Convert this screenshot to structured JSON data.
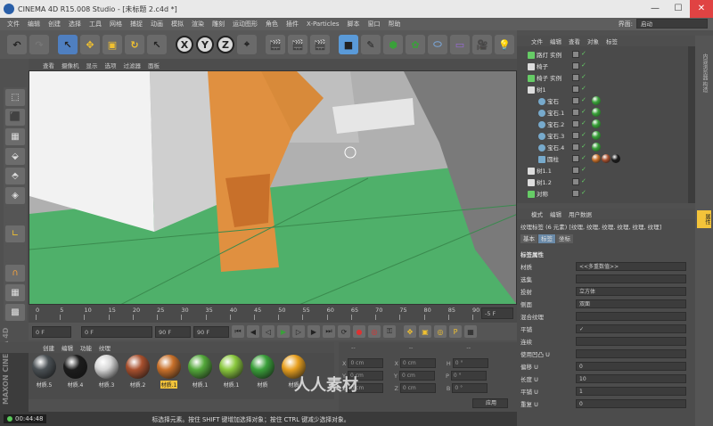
{
  "window": {
    "title": "CINEMA 4D R15.008 Studio - [未标题 2.c4d *]"
  },
  "menu": [
    "文件",
    "编辑",
    "创建",
    "选择",
    "工具",
    "网格",
    "捕捉",
    "动画",
    "模拟",
    "渲染",
    "雕刻",
    "运动图形",
    "角色",
    "插件",
    "X-Particles",
    "脚本",
    "窗口",
    "帮助"
  ],
  "layout": {
    "label": "界面:",
    "value": "启动"
  },
  "viewport": {
    "menu": [
      "查看",
      "摄像机",
      "显示",
      "选项",
      "过滤器",
      "面板"
    ]
  },
  "timeline": {
    "ticks": [
      "0",
      "5",
      "10",
      "15",
      "20",
      "25",
      "30",
      "35",
      "40",
      "45",
      "50",
      "55",
      "60",
      "65",
      "70",
      "75",
      "80",
      "85",
      "90"
    ],
    "end_label": "-5 F"
  },
  "transport": {
    "current": "0 F",
    "start": "0 F",
    "end": "90 F",
    "max": "90 F"
  },
  "materials": {
    "menu": [
      "创建",
      "编辑",
      "功能",
      "纹理"
    ],
    "items": [
      {
        "label": "材质.5",
        "color": "#4a5054"
      },
      {
        "label": "材质.4",
        "color": "#1c1c1c"
      },
      {
        "label": "材质.3",
        "color": "#d6d6d6"
      },
      {
        "label": "材质.2",
        "color": "#a8502e"
      },
      {
        "label": "材质.1",
        "color": "#c8702a",
        "selected": true
      },
      {
        "label": "材质.1",
        "color": "#53a83a"
      },
      {
        "label": "材质.1",
        "color": "#8ac83e"
      },
      {
        "label": "材质",
        "color": "#3aa03a"
      },
      {
        "label": "材质",
        "color": "#e8a020"
      }
    ]
  },
  "coords": {
    "header": [
      "--",
      "--",
      "--"
    ],
    "rows": [
      {
        "a": "X",
        "av": "0 cm",
        "b": "X",
        "bv": "0 cm",
        "c": "H",
        "cv": "0 °"
      },
      {
        "a": "Y",
        "av": "0 cm",
        "b": "Y",
        "bv": "0 cm",
        "c": "P",
        "cv": "0 °"
      },
      {
        "a": "Z",
        "av": "0 cm",
        "b": "Z",
        "bv": "0 cm",
        "c": "B",
        "cv": "0 °"
      }
    ],
    "apply": "应用"
  },
  "status": {
    "time": "00:44:48",
    "message": "标选择元素。按住 SHIFT 键增加选择对象；按住 CTRL 键减少选择对象。"
  },
  "objects": {
    "menu": [
      "文件",
      "编辑",
      "查看",
      "对象",
      "标签"
    ],
    "rows": [
      {
        "name": "路灯 实例",
        "indent": 8,
        "type": "instance"
      },
      {
        "name": "椅子",
        "indent": 8,
        "type": "null"
      },
      {
        "name": "椅子 实例",
        "indent": 8,
        "type": "instance"
      },
      {
        "name": "树1",
        "indent": 8,
        "type": "null"
      },
      {
        "name": "宝石",
        "indent": 20,
        "type": "sphere"
      },
      {
        "name": "宝石.1",
        "indent": 20,
        "type": "sphere"
      },
      {
        "name": "宝石.2",
        "indent": 20,
        "type": "sphere"
      },
      {
        "name": "宝石.3",
        "indent": 20,
        "type": "sphere"
      },
      {
        "name": "宝石.4",
        "indent": 20,
        "type": "sphere"
      },
      {
        "name": "圆柱",
        "indent": 20,
        "type": "cylinder"
      },
      {
        "name": "树1.1",
        "indent": 8,
        "type": "null"
      },
      {
        "name": "树1.2",
        "indent": 8,
        "type": "null"
      },
      {
        "name": "对称",
        "indent": 8,
        "type": "symmetry"
      }
    ]
  },
  "attributes": {
    "menu": [
      "模式",
      "编辑",
      "用户数据"
    ],
    "title": "纹理标签 (6 元素) [纹理, 纹理, 纹理, 纹理, 纹理, 纹理]",
    "tabs": [
      "基本",
      "标签",
      "坐标"
    ],
    "section": "标签属性",
    "fields": [
      {
        "label": "材质",
        "value": "<<多重数值>>"
      },
      {
        "label": "选集",
        "value": ""
      },
      {
        "label": "投射",
        "value": "立方体"
      },
      {
        "label": "侧面",
        "value": "双面"
      },
      {
        "label": "混合纹理",
        "value": ""
      },
      {
        "label": "平铺",
        "value": "✓"
      },
      {
        "label": "连续",
        "value": ""
      },
      {
        "label": "使用凹凸 U",
        "value": ""
      },
      {
        "label": "偏移 U",
        "value": "0"
      },
      {
        "label": "长度 U",
        "value": "10"
      },
      {
        "label": "平铺 U",
        "value": "1"
      },
      {
        "label": "重复 U",
        "value": "0"
      }
    ]
  },
  "rightdock": {
    "tabs": "内容浏览器 构造"
  },
  "watermark": "人人素材"
}
